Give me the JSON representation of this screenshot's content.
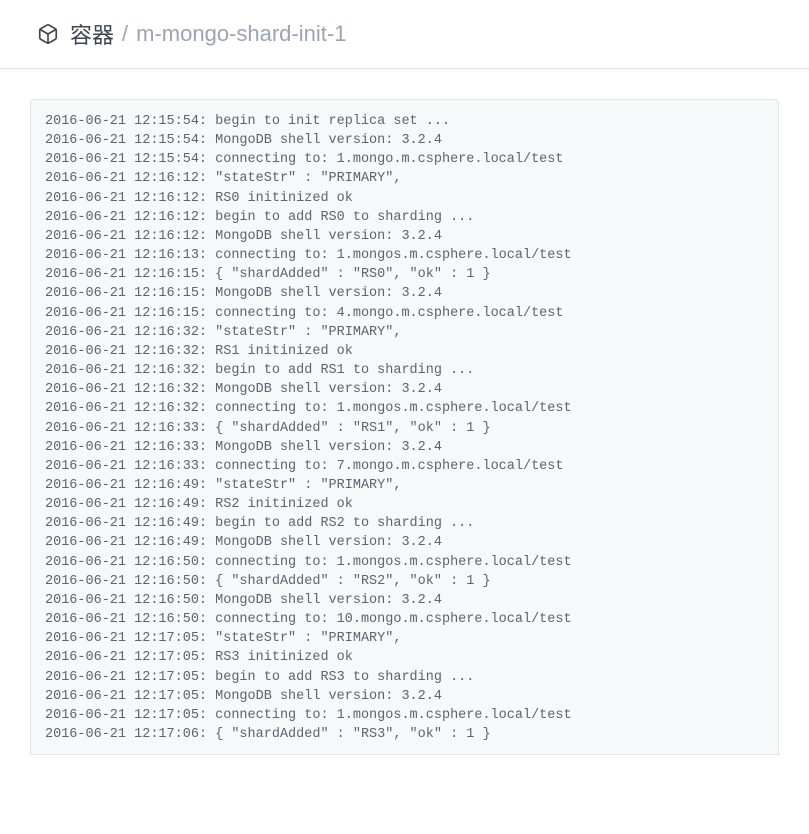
{
  "header": {
    "title": "容器",
    "separator": "/",
    "subtitle": "m-mongo-shard-init-1"
  },
  "logs": [
    "2016-06-21 12:15:54: begin to init replica set ...",
    "2016-06-21 12:15:54: MongoDB shell version: 3.2.4",
    "2016-06-21 12:15:54: connecting to: 1.mongo.m.csphere.local/test",
    "2016-06-21 12:16:12: \"stateStr\" : \"PRIMARY\",",
    "2016-06-21 12:16:12: RS0 initinized ok",
    "2016-06-21 12:16:12: begin to add RS0 to sharding ...",
    "2016-06-21 12:16:12: MongoDB shell version: 3.2.4",
    "2016-06-21 12:16:13: connecting to: 1.mongos.m.csphere.local/test",
    "2016-06-21 12:16:15: { \"shardAdded\" : \"RS0\", \"ok\" : 1 }",
    "2016-06-21 12:16:15: MongoDB shell version: 3.2.4",
    "2016-06-21 12:16:15: connecting to: 4.mongo.m.csphere.local/test",
    "2016-06-21 12:16:32: \"stateStr\" : \"PRIMARY\",",
    "2016-06-21 12:16:32: RS1 initinized ok",
    "2016-06-21 12:16:32: begin to add RS1 to sharding ...",
    "2016-06-21 12:16:32: MongoDB shell version: 3.2.4",
    "2016-06-21 12:16:32: connecting to: 1.mongos.m.csphere.local/test",
    "2016-06-21 12:16:33: { \"shardAdded\" : \"RS1\", \"ok\" : 1 }",
    "2016-06-21 12:16:33: MongoDB shell version: 3.2.4",
    "2016-06-21 12:16:33: connecting to: 7.mongo.m.csphere.local/test",
    "2016-06-21 12:16:49: \"stateStr\" : \"PRIMARY\",",
    "2016-06-21 12:16:49: RS2 initinized ok",
    "2016-06-21 12:16:49: begin to add RS2 to sharding ...",
    "2016-06-21 12:16:49: MongoDB shell version: 3.2.4",
    "2016-06-21 12:16:50: connecting to: 1.mongos.m.csphere.local/test",
    "2016-06-21 12:16:50: { \"shardAdded\" : \"RS2\", \"ok\" : 1 }",
    "2016-06-21 12:16:50: MongoDB shell version: 3.2.4",
    "2016-06-21 12:16:50: connecting to: 10.mongo.m.csphere.local/test",
    "2016-06-21 12:17:05: \"stateStr\" : \"PRIMARY\",",
    "2016-06-21 12:17:05: RS3 initinized ok",
    "2016-06-21 12:17:05: begin to add RS3 to sharding ...",
    "2016-06-21 12:17:05: MongoDB shell version: 3.2.4",
    "2016-06-21 12:17:05: connecting to: 1.mongos.m.csphere.local/test",
    "2016-06-21 12:17:06: { \"shardAdded\" : \"RS3\", \"ok\" : 1 }"
  ]
}
